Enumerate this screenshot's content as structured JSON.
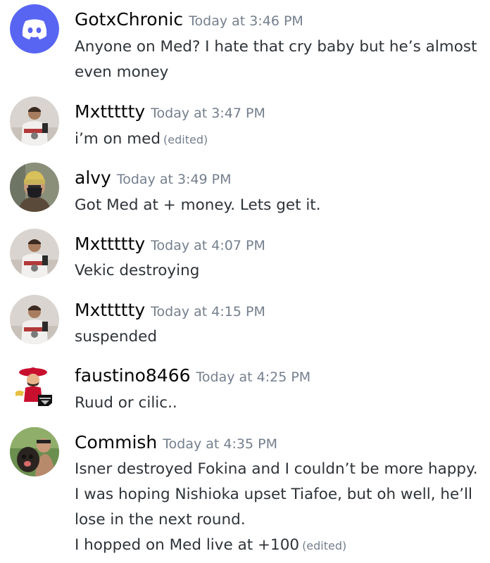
{
  "messages": [
    {
      "username": "GotxChronic",
      "timestamp": "Today at 3:46 PM",
      "lines": [
        "Anyone on Med? I hate that cry baby but he’s almost",
        "even money"
      ],
      "edited": ""
    },
    {
      "username": "Mxttttty",
      "timestamp": "Today at 3:47 PM",
      "lines": [
        "i’m on med"
      ],
      "edited": "(edited)"
    },
    {
      "username": "alvy",
      "timestamp": "Today at 3:49 PM",
      "lines": [
        "Got Med at + money. Lets get it."
      ],
      "edited": ""
    },
    {
      "username": "Mxttttty",
      "timestamp": "Today at 4:07 PM",
      "lines": [
        "Vekic destroying"
      ],
      "edited": ""
    },
    {
      "username": "Mxttttty",
      "timestamp": "Today at 4:15 PM",
      "lines": [
        "suspended"
      ],
      "edited": ""
    },
    {
      "username": "faustino8466",
      "timestamp": "Today at 4:25 PM",
      "lines": [
        "Ruud or cilic.."
      ],
      "edited": ""
    },
    {
      "username": "Commish",
      "timestamp": "Today at 4:35 PM",
      "lines": [
        "Isner destroyed Fokina and I couldn’t be more happy.",
        "I was hoping Nishioka upset Tiafoe, but oh well, he’ll",
        "lose in the next round.",
        "I hopped on Med live at +100"
      ],
      "edited": "(edited)"
    }
  ],
  "avatars": {
    "discord_default": {
      "icon": "discord-logo-icon",
      "color": "#5865f2"
    },
    "hockey_player": {
      "icon": "hockey-player-avatar",
      "color": "#d9d4cf"
    },
    "yellow_hat": {
      "icon": "person-yellow-beanie-avatar",
      "color": "#c9b35a"
    },
    "cartoon_mascot": {
      "icon": "cartoon-sombrero-mascot-avatar",
      "color": "#c8102e"
    },
    "dog_photo": {
      "icon": "person-with-dog-avatar",
      "color": "#6b8f4e"
    }
  }
}
